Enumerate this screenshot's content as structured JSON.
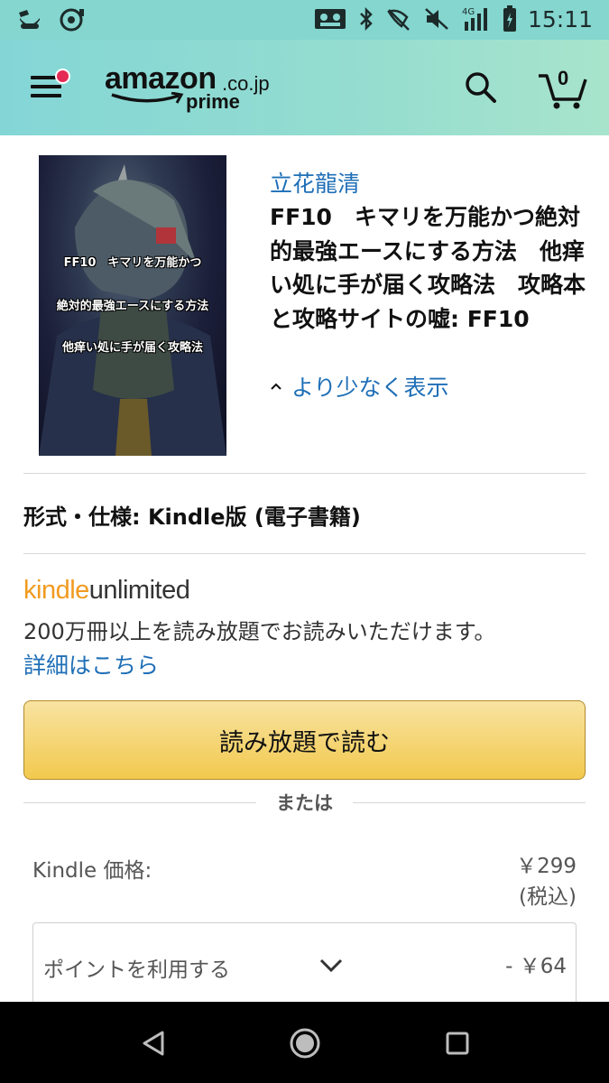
{
  "status_bar": {
    "time": "15:11",
    "network": "4G",
    "icons": [
      "notification-app-icon",
      "notification-app-icon-2",
      "cast-icon",
      "bluetooth-icon",
      "nfc-icon",
      "mute-icon",
      "signal-icon",
      "battery-charging-icon"
    ]
  },
  "header": {
    "logo_main": "amazon",
    "logo_domain": ".co.jp",
    "logo_sub": "prime",
    "cart_count": "0",
    "accent_color": "#84d6cf"
  },
  "book": {
    "author": "立花龍清",
    "title": "FF10　キマリを万能かつ絶対的最強エースにする方法　他痒い処に手が届く攻略法　攻略本と攻略サイトの嘘: FF10",
    "show_less": "より少なく表示",
    "cover_lines": [
      "FF10　キマリを万能かつ",
      "絶対的最強エースにする方法",
      "他痒い処に手が届く攻略法"
    ]
  },
  "format": {
    "text": "形式・仕様: Kindle版 (電子書籍)"
  },
  "kindle_unlimited": {
    "logo_kindle": "kindle",
    "logo_unlimited": "unlimited",
    "description": "200万冊以上を読み放題でお読みいただけます。",
    "details_link": "詳細はこちら",
    "read_button": "読み放題で読む"
  },
  "or_text": "または",
  "price": {
    "label": "Kindle 価格:",
    "value": "￥299",
    "tax": "(税込)"
  },
  "points": {
    "label": "ポイントを利用する",
    "value": "- ￥64"
  }
}
